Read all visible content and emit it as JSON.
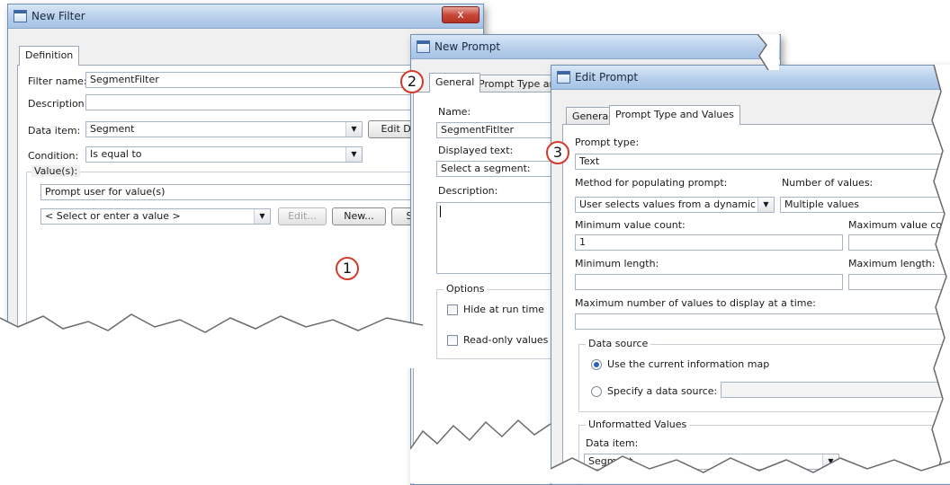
{
  "new_filter": {
    "title": "New Filter",
    "close": "x",
    "tab_definition": "Definition",
    "filter_name_label": "Filter name:",
    "filter_name_value": "SegmentFilter",
    "description_label": "Description:",
    "data_item_label": "Data item:",
    "data_item_value": "Segment",
    "edit_data_button": "Edit Data",
    "condition_label": "Condition:",
    "condition_value": "Is equal to",
    "values_label": "Value(s):",
    "prompt_user_value": "Prompt user for value(s)",
    "select_value_placeholder": "< Select or enter a value >",
    "edit_button": "Edit...",
    "new_button": "New...",
    "s_button": "S"
  },
  "new_prompt": {
    "title": "New Prompt",
    "tab_general": "General",
    "tab_prompt_type": "Prompt Type and Values",
    "name_label": "Name:",
    "name_value": "SegmentFitlter",
    "displayed_text_label": "Displayed text:",
    "displayed_text_value": "Select a segment:",
    "description_label": "Description:",
    "options_label": "Options",
    "hide_at_run_time": "Hide at run time",
    "read_only_values": "Read-only values"
  },
  "edit_prompt": {
    "title": "Edit Prompt",
    "tab_general": "General",
    "tab_prompt_type": "Prompt Type and Values",
    "prompt_type_label": "Prompt type:",
    "prompt_type_value": "Text",
    "method_label": "Method for populating prompt:",
    "method_value": "User selects values from a dynamic list",
    "num_values_label": "Number of values:",
    "num_values_value": "Multiple values",
    "min_value_count_label": "Minimum value count:",
    "min_value_count_value": "1",
    "max_value_count_label": "Maximum value count:",
    "min_length_label": "Minimum length:",
    "max_length_label": "Maximum length:",
    "max_display_label": "Maximum number of values to display at a time:",
    "data_source_label": "Data source",
    "use_current_map": "Use the current information map",
    "specify_source": "Specify a data source:",
    "unformatted_label": "Unformatted Values",
    "data_item_label": "Data item:",
    "data_item_value": "Segment"
  },
  "markers": {
    "one": "1",
    "two": "2",
    "three": "3"
  }
}
